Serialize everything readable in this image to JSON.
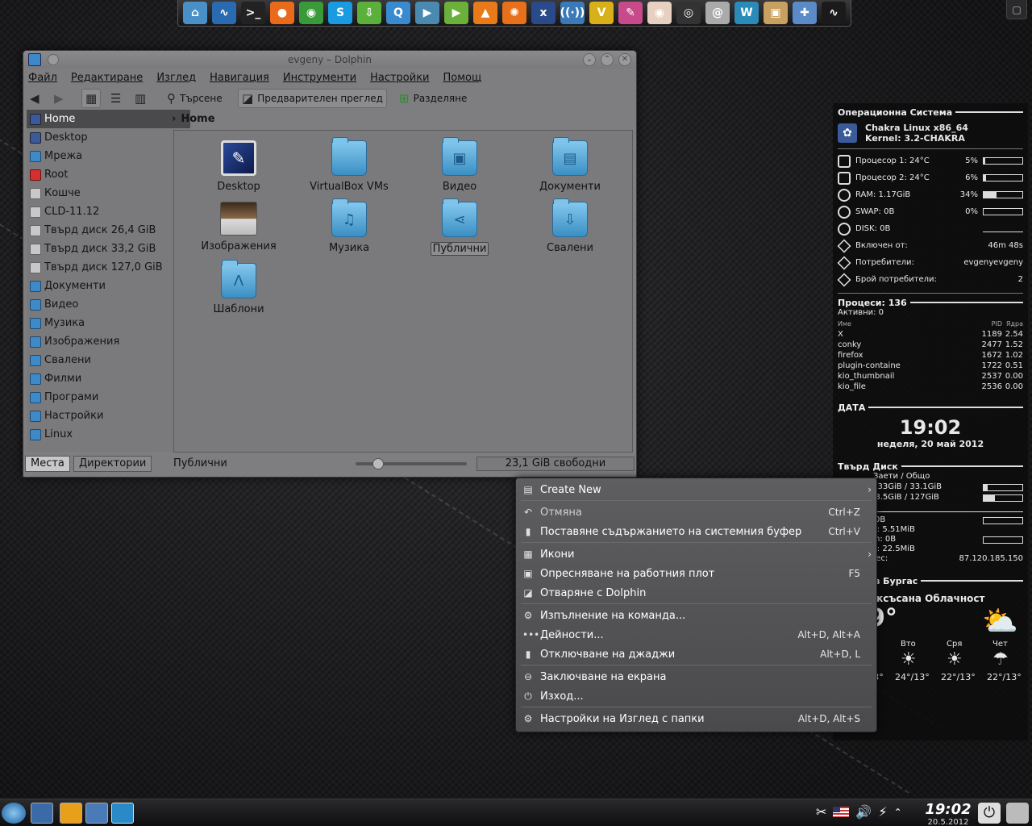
{
  "dock": {
    "apps": [
      {
        "name": "home-icon",
        "color": "#4a90c8",
        "glyph": "⌂"
      },
      {
        "name": "system-monitor-icon",
        "color": "#2a6ab0",
        "glyph": "∿"
      },
      {
        "name": "terminal-icon",
        "color": "#222222",
        "glyph": ">_"
      },
      {
        "name": "firefox-icon",
        "color": "#e86a1a",
        "glyph": "●"
      },
      {
        "name": "chrome-icon",
        "color": "#3a9a3a",
        "glyph": "◉"
      },
      {
        "name": "skype-icon",
        "color": "#1a9ae0",
        "glyph": "S"
      },
      {
        "name": "download-icon",
        "color": "#5ab03a",
        "glyph": "⇩"
      },
      {
        "name": "qbittorrent-icon",
        "color": "#3a8ad0",
        "glyph": "Q"
      },
      {
        "name": "video-player-icon",
        "color": "#4a8ab0",
        "glyph": "▶"
      },
      {
        "name": "video-editor-icon",
        "color": "#6ab03a",
        "glyph": "▶"
      },
      {
        "name": "vlc-icon",
        "color": "#e87a1a",
        "glyph": "▲"
      },
      {
        "name": "burner-icon",
        "color": "#e8701a",
        "glyph": "✺"
      },
      {
        "name": "xbmc-icon",
        "color": "#2a4a8a",
        "glyph": "x"
      },
      {
        "name": "network-icon",
        "color": "#3a7ab8",
        "glyph": "((·))"
      },
      {
        "name": "media-center-icon",
        "color": "#d8b01a",
        "glyph": "V"
      },
      {
        "name": "paint-icon",
        "color": "#c84a8a",
        "glyph": "✎"
      },
      {
        "name": "eye-icon",
        "color": "#e8d0c0",
        "glyph": "◉"
      },
      {
        "name": "camera-icon",
        "color": "#333333",
        "glyph": "◎"
      },
      {
        "name": "swirl-icon",
        "color": "#aaaaaa",
        "glyph": "@"
      },
      {
        "name": "waveform-icon",
        "color": "#2a8ab8",
        "glyph": "W"
      },
      {
        "name": "package-icon",
        "color": "#c8a060",
        "glyph": "▣"
      },
      {
        "name": "tools-icon",
        "color": "#5a8ac8",
        "glyph": "✚"
      },
      {
        "name": "activity-monitor-icon",
        "color": "#1a1a1a",
        "glyph": "∿"
      }
    ]
  },
  "window": {
    "title": "evgeny – Dolphin",
    "menu": [
      "Файл",
      "Редактиране",
      "Изглед",
      "Навигация",
      "Инструменти",
      "Настройки",
      "Помощ"
    ],
    "toolbar": {
      "search": "Търсене",
      "preview": "Предварителен преглед",
      "split": "Разделяне"
    },
    "places": [
      {
        "label": "Home",
        "icon": "dark",
        "active": true
      },
      {
        "label": "Desktop",
        "icon": "dark"
      },
      {
        "label": "Мрежа",
        "icon": ""
      },
      {
        "label": "Root",
        "icon": "red"
      },
      {
        "label": "Кошче",
        "icon": "grey"
      },
      {
        "label": "CLD-11.12",
        "icon": "grey"
      },
      {
        "label": "Твърд диск 26,4 GiB",
        "icon": "grey"
      },
      {
        "label": "Твърд диск 33,2 GiB",
        "icon": "grey"
      },
      {
        "label": "Твърд диск 127,0 GiB",
        "icon": "grey"
      },
      {
        "label": "Документи",
        "icon": ""
      },
      {
        "label": "Видео",
        "icon": ""
      },
      {
        "label": "Музика",
        "icon": ""
      },
      {
        "label": "Изображения",
        "icon": ""
      },
      {
        "label": "Свалени",
        "icon": ""
      },
      {
        "label": "Филми",
        "icon": ""
      },
      {
        "label": "Програми",
        "icon": ""
      },
      {
        "label": "Настройки",
        "icon": ""
      },
      {
        "label": "Linux",
        "icon": ""
      }
    ],
    "breadcrumb": "Home",
    "files": [
      {
        "label": "Desktop",
        "kind": "desktop"
      },
      {
        "label": "VirtualBox VMs",
        "kind": "folder",
        "glyph": ""
      },
      {
        "label": "Видео",
        "kind": "folder",
        "glyph": "▣"
      },
      {
        "label": "Документи",
        "kind": "folder",
        "glyph": "▤"
      },
      {
        "label": "Изображения",
        "kind": "images"
      },
      {
        "label": "Музика",
        "kind": "folder",
        "glyph": "♫"
      },
      {
        "label": "Публични",
        "kind": "folder",
        "glyph": "⋖",
        "selected": true
      },
      {
        "label": "Свалени",
        "kind": "folder",
        "glyph": "⇩"
      },
      {
        "label": "Шаблони",
        "kind": "folder",
        "glyph": "Λ"
      }
    ],
    "status": {
      "tab_places": "Места",
      "tab_dirs": "Директории",
      "text": "Публични",
      "free": "23,1 GiB свободни",
      "zoom": 0.2
    }
  },
  "conky": {
    "system_head": "Операционна Система",
    "os": "Chakra Linux x86_64",
    "kernel": "Kernel: 3.2-CHAKRA",
    "rows": [
      {
        "label": "Процесор 1: 24°C",
        "value": "5%",
        "fill": 0.05,
        "icon": "sq"
      },
      {
        "label": "Процесор 2: 24°C",
        "value": "6%",
        "fill": 0.06,
        "icon": "sq"
      },
      {
        "label": "RAM: 1.17GiB",
        "value": "34%",
        "fill": 0.34,
        "icon": ""
      },
      {
        "label": "SWAP: 0B",
        "value": "0%",
        "fill": 0,
        "icon": ""
      },
      {
        "label": "DISK: 0B",
        "value": "",
        "fill": null,
        "icon": ""
      },
      {
        "label": "Включен от:",
        "value": "46m 48s",
        "fill": null,
        "icon": "dia"
      },
      {
        "label": "Потребители:",
        "value": "evgenyevgeny",
        "fill": null,
        "icon": "dia"
      },
      {
        "label": "Брой потребители:",
        "value": "2",
        "fill": null,
        "icon": "dia"
      }
    ],
    "proc_head": "Процеси: 136",
    "active": "Активни: 0",
    "proc_cols": [
      "Име",
      "PID",
      "Ядра"
    ],
    "procs": [
      [
        "X",
        "1189",
        "2.54"
      ],
      [
        "conky",
        "2477",
        "1.52"
      ],
      [
        "firefox",
        "1672",
        "1.02"
      ],
      [
        "plugin-containe",
        "1722",
        "0.51"
      ],
      [
        "kio_thumbnail",
        "2537",
        "0.00"
      ],
      [
        "kio_file",
        "2536",
        "0.00"
      ]
    ],
    "date_head": "ДАТА",
    "time": "19:02",
    "date": "неделя, 20 май 2012",
    "disk_head": "Твърд Диск",
    "disk_cols": "Заети  /  Общо",
    "disks": [
      {
        "text": "3.33GiB / 33.1GiB",
        "fill": 0.1
      },
      {
        "text": "38.5GiB / 127GiB",
        "fill": 0.3
      }
    ],
    "net_lines": [
      "0B",
      "l: 5.51MiB",
      "n: 0B",
      "l: 22.5MiB"
    ],
    "ip_label": "дрес:",
    "ip": "87.120.185.150",
    "weather_head": "о в Бургас",
    "condition": "аксъсана Облачност",
    "temp": "9°",
    "days": [
      "Вто",
      "Сря",
      "Чет"
    ],
    "temps": [
      "24°/13°",
      "24°/13°",
      "22°/13°",
      "22°/13°"
    ]
  },
  "menu": {
    "items": [
      {
        "label": "Create New",
        "icon": "▤",
        "shortcut": "",
        "arrow": true,
        "dim": false
      },
      {
        "label": "Отмяна",
        "icon": "↶",
        "shortcut": "Ctrl+Z",
        "dim": true
      },
      {
        "label": "Поставяне съдържанието на системния буфер",
        "icon": "▮",
        "shortcut": "Ctrl+V"
      },
      {
        "label": "Икони",
        "icon": "▦",
        "shortcut": "",
        "arrow": true
      },
      {
        "label": "Опресняване на работния плот",
        "icon": "▣",
        "shortcut": "F5"
      },
      {
        "label": "Отваряне с Dolphin",
        "icon": "◪",
        "shortcut": ""
      },
      {
        "label": "Изпълнение на команда...",
        "icon": "⚙",
        "shortcut": ""
      },
      {
        "label": "Дейности...",
        "icon": "•••",
        "shortcut": "Alt+D, Alt+A"
      },
      {
        "label": "Отключване на джаджи",
        "icon": "▮",
        "shortcut": "Alt+D, L"
      },
      {
        "label": "Заключване на екрана",
        "icon": "⊖",
        "shortcut": ""
      },
      {
        "label": "Изход...",
        "icon": "⏻",
        "shortcut": ""
      },
      {
        "label": "Настройки на Изглед с папки",
        "icon": "⚙",
        "shortcut": "Alt+D, Alt+S"
      }
    ]
  },
  "taskbar": {
    "time": "19:02",
    "date": "20.5.2012"
  }
}
